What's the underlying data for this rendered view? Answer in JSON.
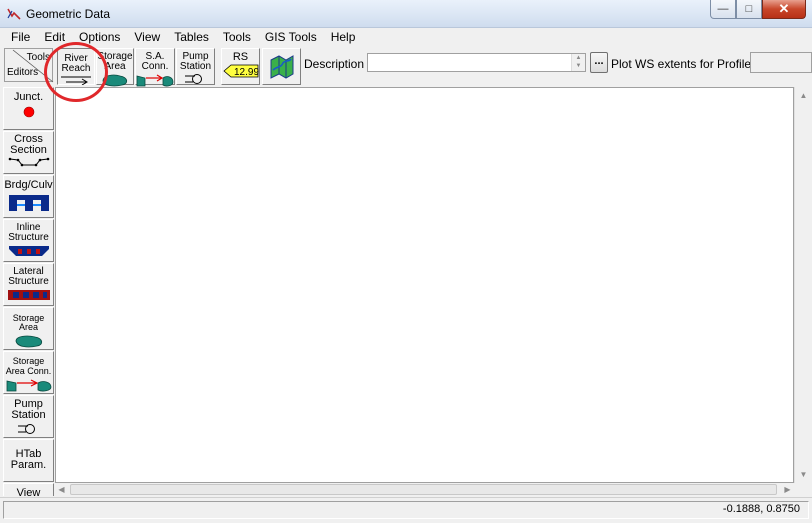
{
  "window": {
    "title": "Geometric Data"
  },
  "menu": [
    "File",
    "Edit",
    "Options",
    "View",
    "Tables",
    "Tools",
    "GIS Tools",
    "Help"
  ],
  "toolbar": {
    "tools_label": "Tools",
    "editors_label": "Editors",
    "river_reach": [
      "River",
      "Reach"
    ],
    "storage_area": [
      "Storage",
      "Area"
    ],
    "sa_conn": [
      "S.A.",
      "Conn."
    ],
    "pump_station": [
      "Pump",
      "Station"
    ],
    "rs_label": "RS",
    "rs_value": "12.99",
    "description_label": "Description :",
    "description_value": "",
    "ellipsis_label": "...",
    "plot_ws_label": "Plot WS extents for Profile:",
    "plot_ws_value": ""
  },
  "palette": {
    "junct": "Junct.",
    "cross_section": [
      "Cross",
      "Section"
    ],
    "bridge_culvert": "Brdg/Culv",
    "inline_structure": [
      "Inline",
      "Structure"
    ],
    "lateral_structure": [
      "Lateral",
      "Structure"
    ],
    "storage_area": [
      "Storage",
      "Area"
    ],
    "storage_area_conn": [
      "Storage",
      "Area Conn."
    ],
    "pump_station": [
      "Pump",
      "Station"
    ],
    "htab_param": [
      "HTab",
      "Param."
    ],
    "view": "View"
  },
  "status": {
    "coordinates": "-0.1888, 0.8750"
  },
  "colors": {
    "highlight": "#e0282b",
    "junction_red": "#ff0000",
    "storage_teal": "#1a8a7a",
    "structure_navy": "#0a2a8a",
    "structure_red": "#a01010"
  }
}
